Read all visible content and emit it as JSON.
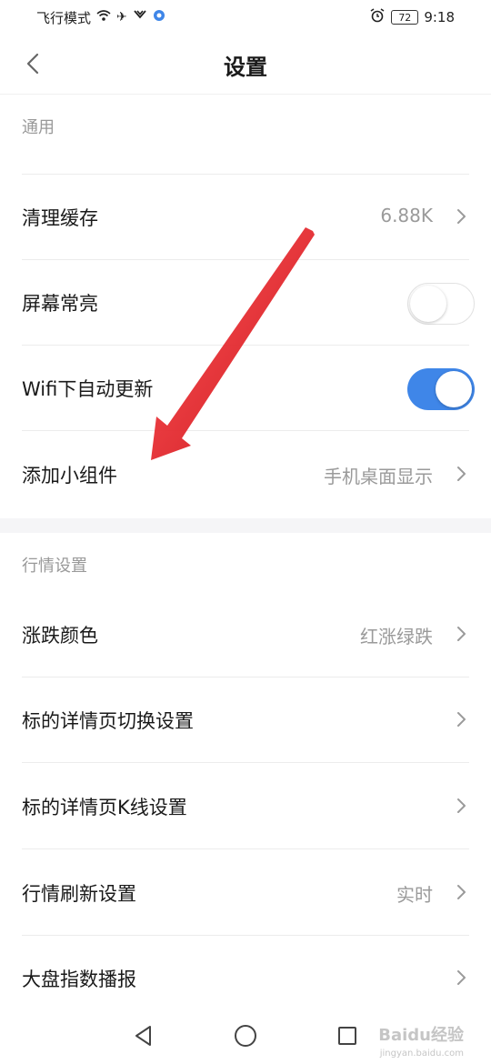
{
  "status_bar": {
    "carrier_mode": "飞行模式",
    "battery": "72",
    "time": "9:18",
    "icons": [
      "wifi-icon",
      "airplane-icon",
      "signal-icon",
      "app-notification-icon",
      "alarm-icon",
      "battery-icon"
    ]
  },
  "header": {
    "title": "设置",
    "back_icon": "chevron-left-icon"
  },
  "sections": [
    {
      "title": "通用",
      "rows": [
        {
          "label": "清理缓存",
          "value": "6.88K",
          "control": "chevron"
        },
        {
          "label": "屏幕常亮",
          "control": "toggle",
          "on": false
        },
        {
          "label": "Wifi下自动更新",
          "control": "toggle",
          "on": true
        },
        {
          "label": "添加小组件",
          "value": "手机桌面显示",
          "control": "chevron"
        }
      ]
    },
    {
      "title": "行情设置",
      "rows": [
        {
          "label": "涨跌颜色",
          "value": "红涨绿跌",
          "control": "chevron"
        },
        {
          "label": "标的详情页切换设置",
          "control": "chevron"
        },
        {
          "label": "标的详情页K线设置",
          "control": "chevron"
        },
        {
          "label": "行情刷新设置",
          "value": "实时",
          "control": "chevron"
        },
        {
          "label": "大盘指数播报",
          "control": "chevron"
        }
      ]
    }
  ],
  "colors": {
    "toggle_on": "#3f86e8",
    "annotation_arrow": "#e3161c",
    "section_title": "#999999"
  },
  "nav_bar": {
    "icons": [
      "back-triangle-icon",
      "home-circle-icon",
      "recents-square-icon"
    ]
  },
  "watermark": {
    "text": "Baidu经验",
    "subtext": "jingyan.baidu.com"
  }
}
